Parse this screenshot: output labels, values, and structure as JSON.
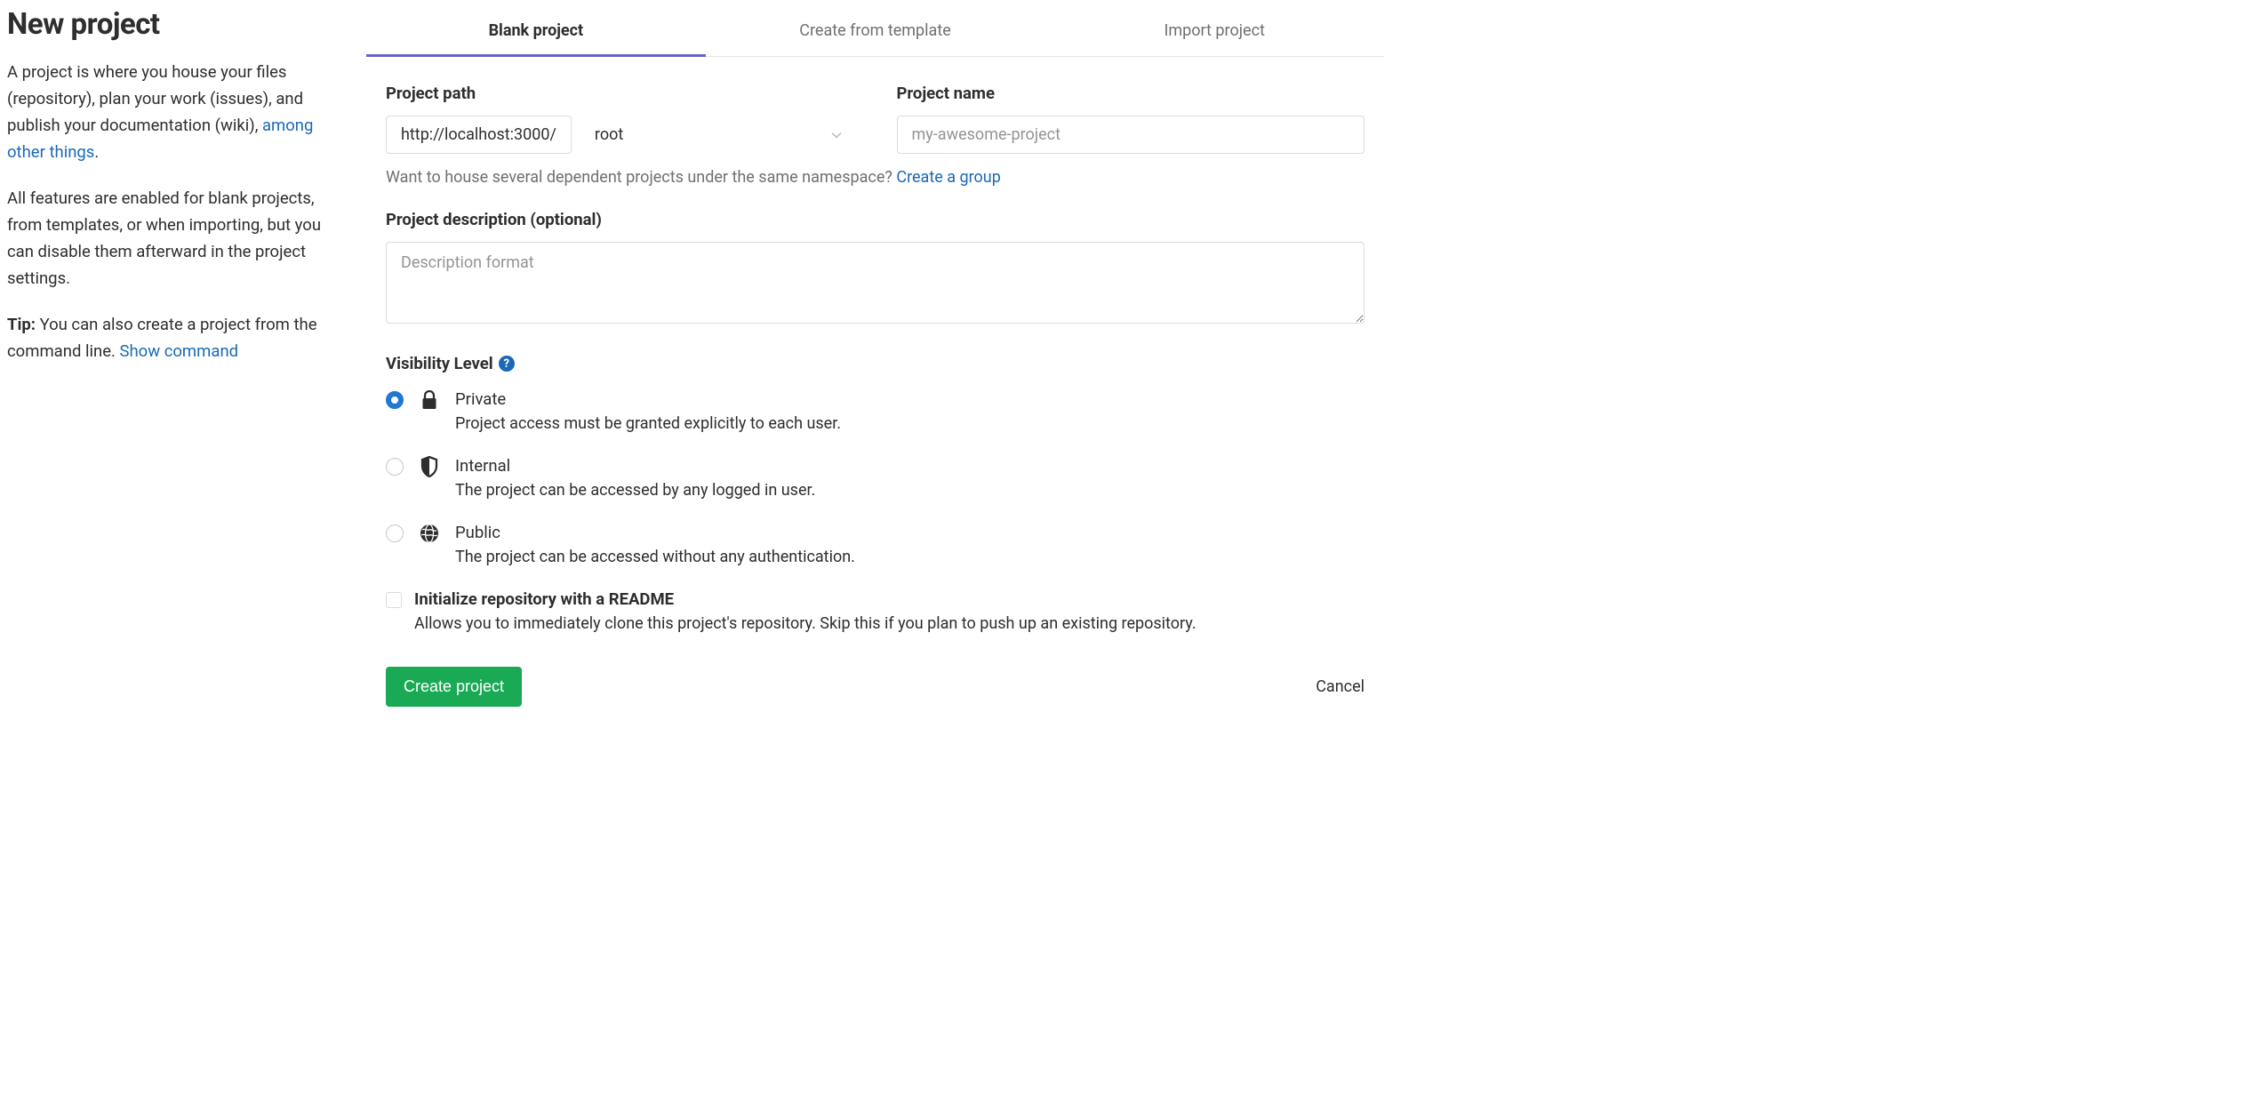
{
  "sidebar": {
    "title": "New project",
    "p1_a": "A project is where you house your files (repository), plan your work (issues), and publish your documentation (wiki), ",
    "p1_link": "among other things",
    "p1_b": ".",
    "p2": "All features are enabled for blank projects, from templates, or when importing, but you can disable them afterward in the project settings.",
    "tip_label": "Tip:",
    "tip_text": " You can also create a project from the command line. ",
    "tip_link": "Show command"
  },
  "tabs": [
    {
      "label": "Blank project",
      "active": true
    },
    {
      "label": "Create from template",
      "active": false
    },
    {
      "label": "Import project",
      "active": false
    }
  ],
  "form": {
    "path_label": "Project path",
    "name_label": "Project name",
    "host_prefix": "http://localhost:3000/",
    "namespace_selected": "root",
    "name_placeholder": "my-awesome-project",
    "group_hint_text": "Want to house several dependent projects under the same namespace? ",
    "group_hint_link": "Create a group",
    "desc_label": "Project description (optional)",
    "desc_placeholder": "Description format",
    "visibility_label": "Visibility Level",
    "visibility_options": [
      {
        "key": "private",
        "title": "Private",
        "desc": "Project access must be granted explicitly to each user.",
        "checked": true
      },
      {
        "key": "internal",
        "title": "Internal",
        "desc": "The project can be accessed by any logged in user.",
        "checked": false
      },
      {
        "key": "public",
        "title": "Public",
        "desc": "The project can be accessed without any authentication.",
        "checked": false
      }
    ],
    "readme_title": "Initialize repository with a README",
    "readme_desc": "Allows you to immediately clone this project's repository. Skip this if you plan to push up an existing repository.",
    "submit_label": "Create project",
    "cancel_label": "Cancel"
  }
}
